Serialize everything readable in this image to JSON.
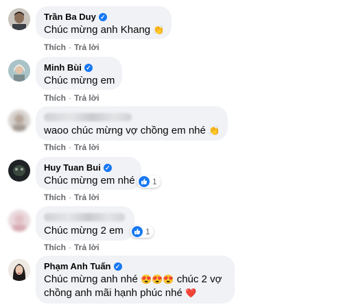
{
  "actions": {
    "like": "Thích",
    "reply": "Trả lời",
    "sep": "·"
  },
  "comments": [
    {
      "name": "Trần Ba Duy",
      "text": "Chúc mừng anh Khang",
      "emoji": "👏"
    },
    {
      "name": "Minh Bùi",
      "text": "Chúc mừng em"
    },
    {
      "name": "",
      "text": "waoo chúc mừng vợ chồng em nhé",
      "emoji": "👏"
    },
    {
      "name": "Huy Tuan Bui",
      "text": "Chúc mừng em nhé",
      "likes": "1"
    },
    {
      "name": "",
      "text": "Chúc mừng 2 em",
      "likes": "1"
    },
    {
      "name": "Phạm Anh Tuấn",
      "text": "Chúc mừng anh nhé",
      "emoji_heart_eyes": "😍😍😍",
      "text2": "chúc 2 vợ chồng anh mãi hạnh phúc nhé",
      "heart": "❤️"
    }
  ],
  "colors": {
    "accent": "#1877f2",
    "bubble": "#f0f2f5",
    "meta": "#65676b",
    "heart": "#e41e3f"
  },
  "icons": [
    "verified-badge-icon",
    "clapping-hands-icon",
    "like-reaction-icon",
    "heart-icon"
  ]
}
